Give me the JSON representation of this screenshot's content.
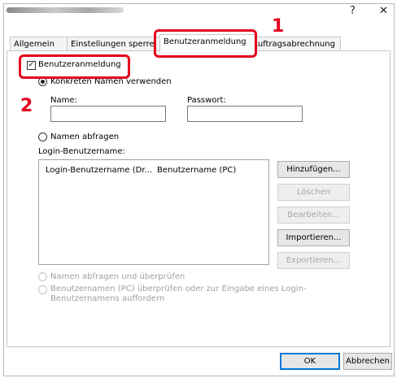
{
  "window": {
    "close_glyph": "✕",
    "help_glyph": "?"
  },
  "tabs": [
    "Allgemein",
    "Einstellungen sperre",
    "Benutzeranmeldung",
    "Auftragsabrechnung"
  ],
  "callouts": {
    "one": "1",
    "two": "2"
  },
  "login": {
    "checkbox_label": "Benutzeranmeldung",
    "checkbox_mark": "✓",
    "option_specific": "Konkreten Namen verwenden",
    "name_label": "Name:",
    "name_value": "",
    "password_label": "Passwort:",
    "password_value": "",
    "option_prompt": "Namen abfragen",
    "list_label": "Login-Benutzername:",
    "list_columns": [
      "Login-Benutzername (Dr...",
      "Benutzername (PC)"
    ],
    "option_prompt_check": "Namen abfragen und überprüfen",
    "option_verify": "Benutzernamen (PC) überprüfen oder zur Eingabe eines Login-Benutzernamens auffordern"
  },
  "list_buttons": {
    "add": "Hinzufügen...",
    "delete": "Löschen",
    "edit": "Bearbeiten...",
    "import": "Importieren...",
    "export": "Exportieren..."
  },
  "footer": {
    "ok": "OK",
    "cancel": "Abbrechen"
  },
  "colors": {
    "callout": "#e4001c",
    "accent": "#0078d7"
  }
}
